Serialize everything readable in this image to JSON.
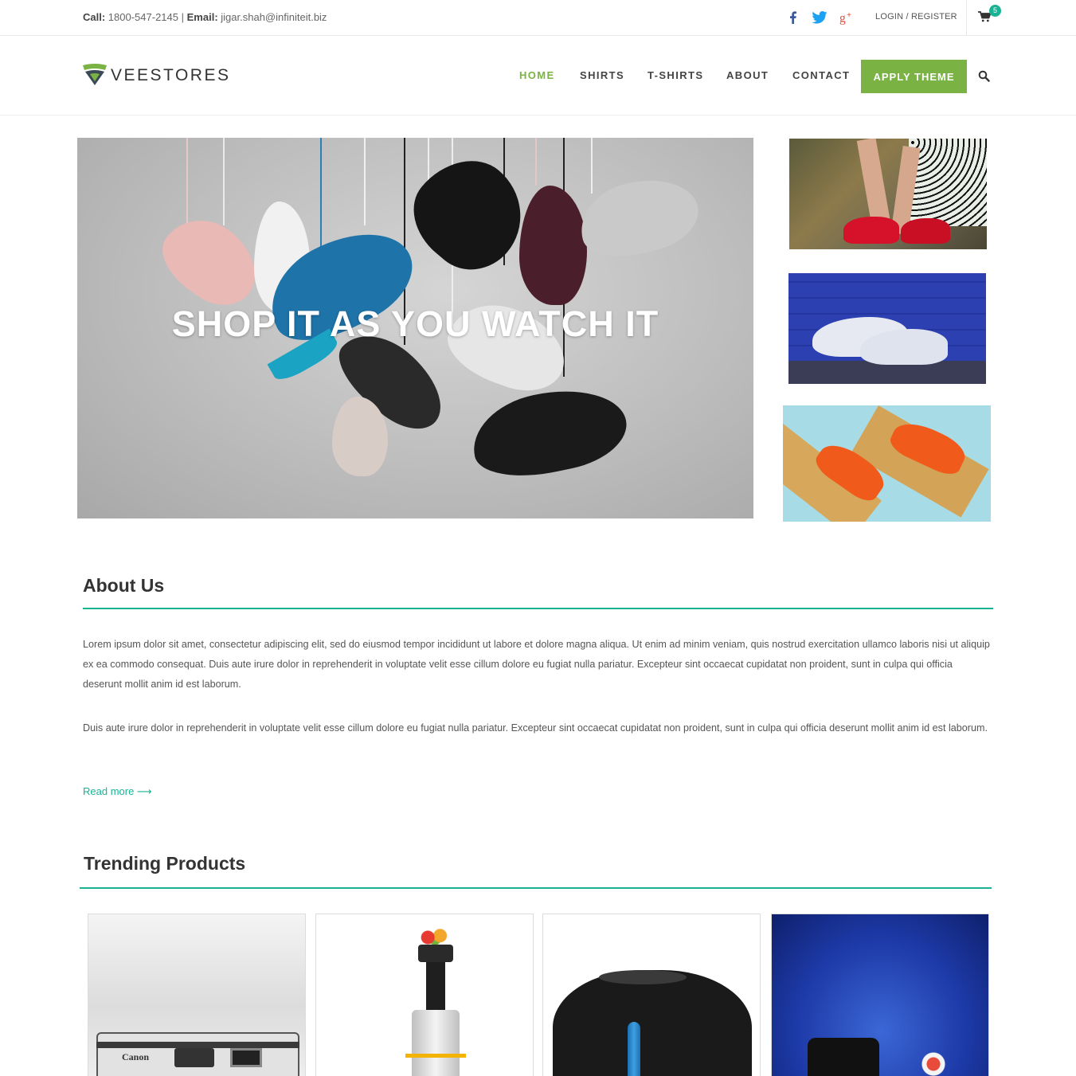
{
  "topbar": {
    "call_label": "Call:",
    "phone": "1800-547-2145",
    "separator": "|",
    "email_label": "Email:",
    "email": "jigar.shah@infiniteit.biz",
    "social": [
      "facebook-icon",
      "twitter-icon",
      "google-plus-icon"
    ],
    "login_register": "LOGIN / REGISTER",
    "cart_count": "5"
  },
  "header": {
    "logo": "VEESTORES",
    "nav": [
      {
        "label": "HOME",
        "active": true
      },
      {
        "label": "SHIRTS",
        "active": false
      },
      {
        "label": "T-SHIRTS",
        "active": false
      },
      {
        "label": "ABOUT",
        "active": false
      },
      {
        "label": "CONTACT",
        "active": false
      }
    ],
    "apply_button": "APPLY THEME",
    "search_icon": "search-icon"
  },
  "hero": {
    "headline": "SHOP IT AS YOU WATCH IT"
  },
  "about": {
    "title": "About Us",
    "paragraph1": "Lorem ipsum dolor sit amet, consectetur adipiscing elit, sed do eiusmod tempor incididunt ut labore et dolore magna aliqua. Ut enim ad minim veniam, quis nostrud exercitation ullamco laboris nisi ut aliquip ex ea commodo consequat. Duis aute irure dolor in reprehenderit in voluptate velit esse cillum dolore eu fugiat nulla pariatur. Excepteur sint occaecat cupidatat non proident, sunt in culpa qui officia deserunt mollit anim id est laborum.",
    "paragraph2": "Duis aute irure dolor in reprehenderit in voluptate velit esse cillum dolore eu fugiat nulla pariatur. Excepteur sint occaecat cupidatat non proident, sunt in culpa qui officia deserunt mollit anim id est laborum.",
    "read_more": "Read more ⟶"
  },
  "trending": {
    "title": "Trending Products",
    "camera_brand": "Canon"
  },
  "colors": {
    "accent_green": "#7ab344",
    "teal": "#19b394"
  }
}
